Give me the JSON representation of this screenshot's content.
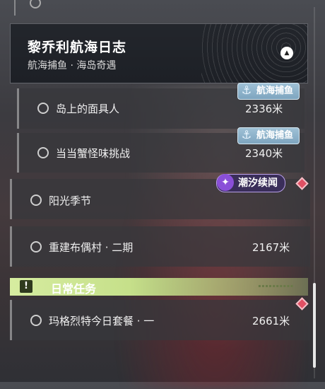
{
  "header": {
    "title": "黎乔利航海日志",
    "subtitle": "航海捕鱼 · 海岛奇遇"
  },
  "quests": [
    {
      "name": "岛上的面具人",
      "distance": "2336米",
      "badge": "航海捕鱼"
    },
    {
      "name": "当当蟹怪味挑战",
      "distance": "2340米",
      "badge": "航海捕鱼"
    },
    {
      "name": "阳光季节",
      "distance": "",
      "badge": "潮汐续闻"
    },
    {
      "name": "重建布偶村 · 二期",
      "distance": "2167米",
      "badge": ""
    }
  ],
  "daily": {
    "section_title": "日常任务",
    "section_icon": "!",
    "items": [
      {
        "name": "玛格烈特今日套餐 · 一",
        "distance": "2661米"
      }
    ]
  },
  "colors": {
    "fishing_badge": "#8fb3cb",
    "tide_badge_icon": "#8a4fd8",
    "alert_diamond": "#e05064",
    "daily_section": "#c6e08a"
  }
}
